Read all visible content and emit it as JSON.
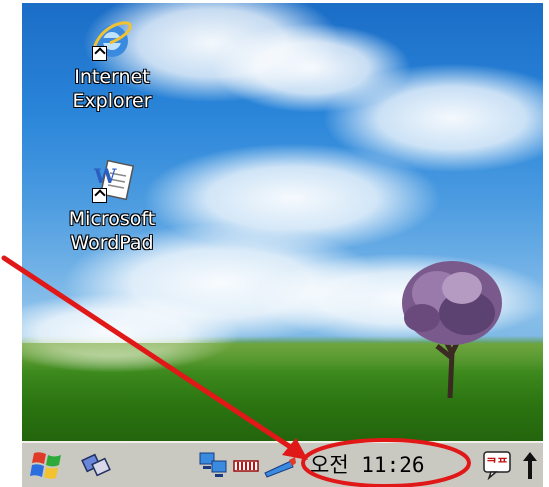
{
  "desktop": {
    "icons": [
      {
        "label_line1": "Internet",
        "label_line2": "Explorer",
        "icon": "internet-explorer-icon"
      },
      {
        "label_line1": "Microsoft",
        "label_line2": "WordPad",
        "icon": "wordpad-icon"
      }
    ]
  },
  "taskbar": {
    "start_icon": "windows-flag-icon",
    "switcher_icon": "task-switcher-icon",
    "tray_icons": [
      "network-connection-icon",
      "battery-icon",
      "pen-icon"
    ],
    "clock": "오전 11:26",
    "ime_icon": "input-method-icon",
    "ime_label": "ᄏᄑ",
    "scroll_icon": "arrow-up-icon"
  },
  "annotation": {
    "color": "#e01818"
  }
}
